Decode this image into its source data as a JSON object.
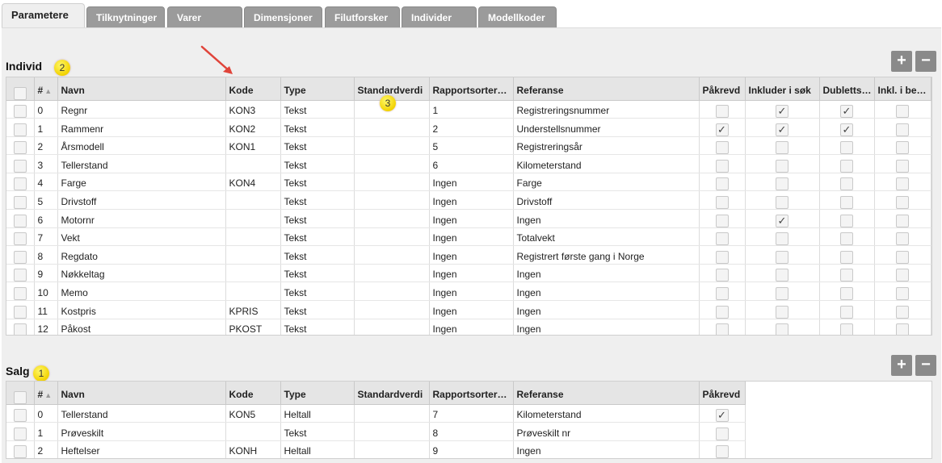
{
  "tabs": [
    "Parametere",
    "Tilknytninger",
    "Varer",
    "Dimensjoner",
    "Filutforsker",
    "Individer",
    "Modellkoder"
  ],
  "columns": {
    "num": "#",
    "navn": "Navn",
    "kode": "Kode",
    "type": "Type",
    "standardverdi": "Standardverdi",
    "rapport": "Rapportsorter…",
    "referanse": "Referanse",
    "pakrevd": "Påkrevd",
    "inkluder": "Inkluder i søk",
    "dublett": "Dubletts…",
    "inkl": "Inkl. i be…"
  },
  "individ": {
    "title": "Individ",
    "callout": "2",
    "rows": [
      {
        "n": "0",
        "navn": "Regnr",
        "kode": "KON3",
        "type": "Tekst",
        "std": "",
        "rap": "1",
        "ref": "Registreringsnummer",
        "p": false,
        "i": true,
        "d": true,
        "b": false
      },
      {
        "n": "1",
        "navn": "Rammenr",
        "kode": "KON2",
        "type": "Tekst",
        "std": "",
        "rap": "2",
        "ref": "Understellsnummer",
        "p": true,
        "i": true,
        "d": true,
        "b": false
      },
      {
        "n": "2",
        "navn": "Årsmodell",
        "kode": "KON1",
        "type": "Tekst",
        "std": "",
        "rap": "5",
        "ref": "Registreringsår",
        "p": false,
        "i": false,
        "d": false,
        "b": false
      },
      {
        "n": "3",
        "navn": "Tellerstand",
        "kode": "",
        "type": "Tekst",
        "std": "",
        "rap": "6",
        "ref": "Kilometerstand",
        "p": false,
        "i": false,
        "d": false,
        "b": false
      },
      {
        "n": "4",
        "navn": "Farge",
        "kode": "KON4",
        "type": "Tekst",
        "std": "",
        "rap": "Ingen",
        "ref": "Farge",
        "p": false,
        "i": false,
        "d": false,
        "b": false
      },
      {
        "n": "5",
        "navn": "Drivstoff",
        "kode": "",
        "type": "Tekst",
        "std": "",
        "rap": "Ingen",
        "ref": "Drivstoff",
        "p": false,
        "i": false,
        "d": false,
        "b": false
      },
      {
        "n": "6",
        "navn": "Motornr",
        "kode": "",
        "type": "Tekst",
        "std": "",
        "rap": "Ingen",
        "ref": "Ingen",
        "p": false,
        "i": true,
        "d": false,
        "b": false
      },
      {
        "n": "7",
        "navn": "Vekt",
        "kode": "",
        "type": "Tekst",
        "std": "",
        "rap": "Ingen",
        "ref": "Totalvekt",
        "p": false,
        "i": false,
        "d": false,
        "b": false
      },
      {
        "n": "8",
        "navn": "Regdato",
        "kode": "",
        "type": "Tekst",
        "std": "",
        "rap": "Ingen",
        "ref": "Registrert første gang i Norge",
        "p": false,
        "i": false,
        "d": false,
        "b": false
      },
      {
        "n": "9",
        "navn": "Nøkkeltag",
        "kode": "",
        "type": "Tekst",
        "std": "",
        "rap": "Ingen",
        "ref": "Ingen",
        "p": false,
        "i": false,
        "d": false,
        "b": false
      },
      {
        "n": "10",
        "navn": "Memo",
        "kode": "",
        "type": "Tekst",
        "std": "",
        "rap": "Ingen",
        "ref": "Ingen",
        "p": false,
        "i": false,
        "d": false,
        "b": false
      },
      {
        "n": "11",
        "navn": "Kostpris",
        "kode": "KPRIS",
        "type": "Tekst",
        "std": "",
        "rap": "Ingen",
        "ref": "Ingen",
        "p": false,
        "i": false,
        "d": false,
        "b": false
      },
      {
        "n": "12",
        "navn": "Påkost",
        "kode": "PKOST",
        "type": "Tekst",
        "std": "",
        "rap": "Ingen",
        "ref": "Ingen",
        "p": false,
        "i": false,
        "d": false,
        "b": false
      }
    ]
  },
  "salg": {
    "title": "Salg",
    "callout": "1",
    "rows": [
      {
        "n": "0",
        "navn": "Tellerstand",
        "kode": "KON5",
        "type": "Heltall",
        "std": "",
        "rap": "7",
        "ref": "Kilometerstand",
        "p": true
      },
      {
        "n": "1",
        "navn": "Prøveskilt",
        "kode": "",
        "type": "Tekst",
        "std": "",
        "rap": "8",
        "ref": "Prøveskilt nr",
        "p": false
      },
      {
        "n": "2",
        "navn": "Heftelser",
        "kode": "KONH",
        "type": "Heltall",
        "std": "",
        "rap": "9",
        "ref": "Ingen",
        "p": false
      }
    ]
  },
  "standardverdi_callout": "3",
  "buttons": {
    "add": "+",
    "remove": "−"
  },
  "colors": {
    "tab_inactive": "#9b9b9b",
    "panel": "#efefef",
    "callout": "#f2d200",
    "arrow": "#e0443a"
  }
}
